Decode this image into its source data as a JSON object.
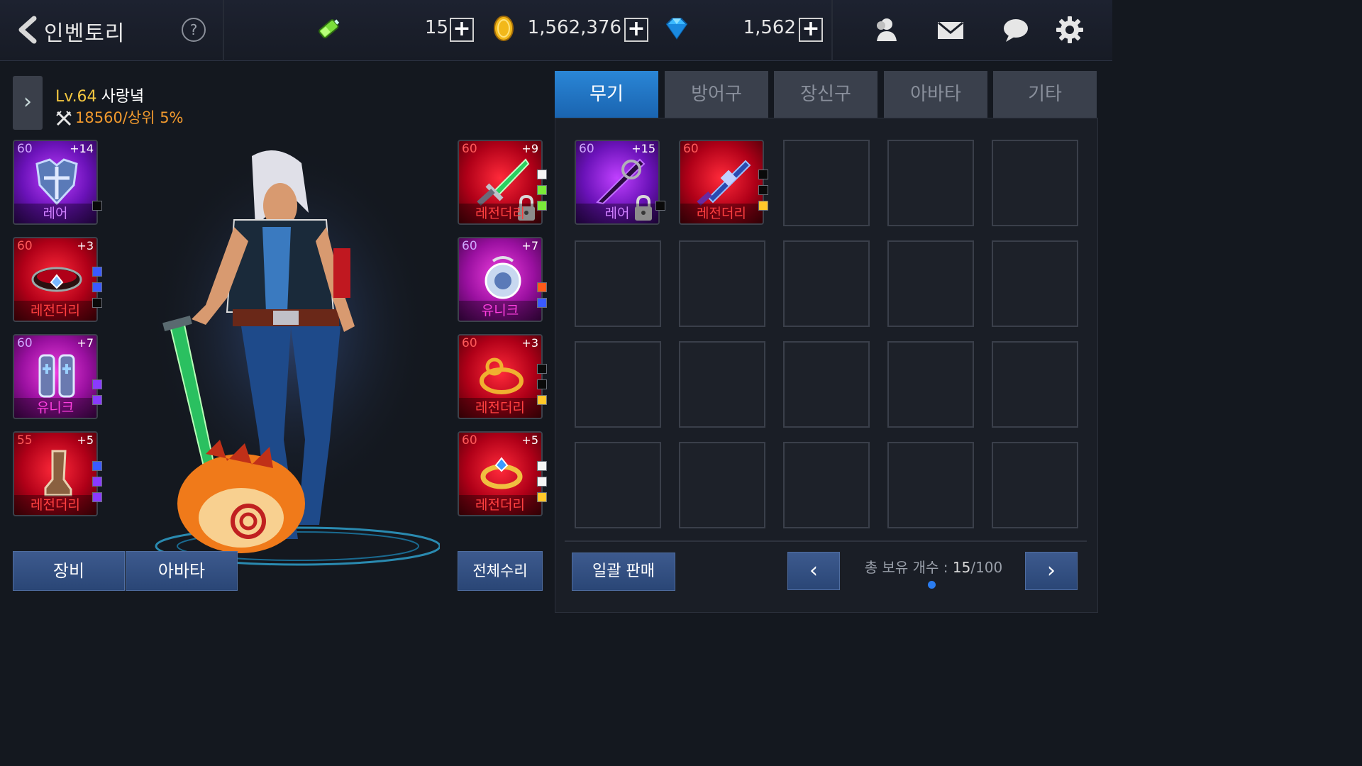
{
  "header": {
    "title": "인벤토리",
    "help_label": "?",
    "stamina": "15",
    "gold": "1,562,376",
    "gems": "1,562",
    "plus_label": "+"
  },
  "character": {
    "level": "Lv.64",
    "name": "사랑녘",
    "power": "18560/상위 5%"
  },
  "equipment_left": [
    {
      "level": "60",
      "enhance": "+14",
      "grade": "레어",
      "icon": "chest-armor-icon"
    },
    {
      "level": "60",
      "enhance": "+3",
      "grade": "레전더리",
      "icon": "belt-icon"
    },
    {
      "level": "60",
      "enhance": "+7",
      "grade": "유니크",
      "icon": "leg-armor-icon"
    },
    {
      "level": "55",
      "enhance": "+5",
      "grade": "레전더리",
      "icon": "boots-icon"
    }
  ],
  "equipment_right": [
    {
      "level": "60",
      "enhance": "+9",
      "grade": "레전더리",
      "icon": "green-sword-icon"
    },
    {
      "level": "60",
      "enhance": "+7",
      "grade": "유니크",
      "icon": "amulet-icon"
    },
    {
      "level": "60",
      "enhance": "+3",
      "grade": "레전더리",
      "icon": "bracelet-icon"
    },
    {
      "level": "60",
      "enhance": "+5",
      "grade": "레전더리",
      "icon": "ring-icon"
    }
  ],
  "buttons": {
    "equip": "장비",
    "avatar": "아바타",
    "repair_all": "전체수리",
    "bulk_sell": "일괄 판매"
  },
  "tabs": [
    "무기",
    "방어구",
    "장신구",
    "아바타",
    "기타"
  ],
  "inventory_items": [
    {
      "level": "60",
      "enhance": "+15",
      "grade": "레어",
      "icon": "dark-sword-icon"
    },
    {
      "level": "60",
      "enhance": "",
      "grade": "레전더리",
      "icon": "blue-blade-icon"
    }
  ],
  "footer": {
    "count_prefix": "총 보유 개수 : ",
    "count_current": "15",
    "count_max": "/100",
    "prev": "‹",
    "next": "›"
  },
  "colors": {
    "accent": "#1a64b0",
    "legendary": "#ff4040",
    "gold_text": "#f2c640",
    "power_text": "#f29a2e"
  }
}
